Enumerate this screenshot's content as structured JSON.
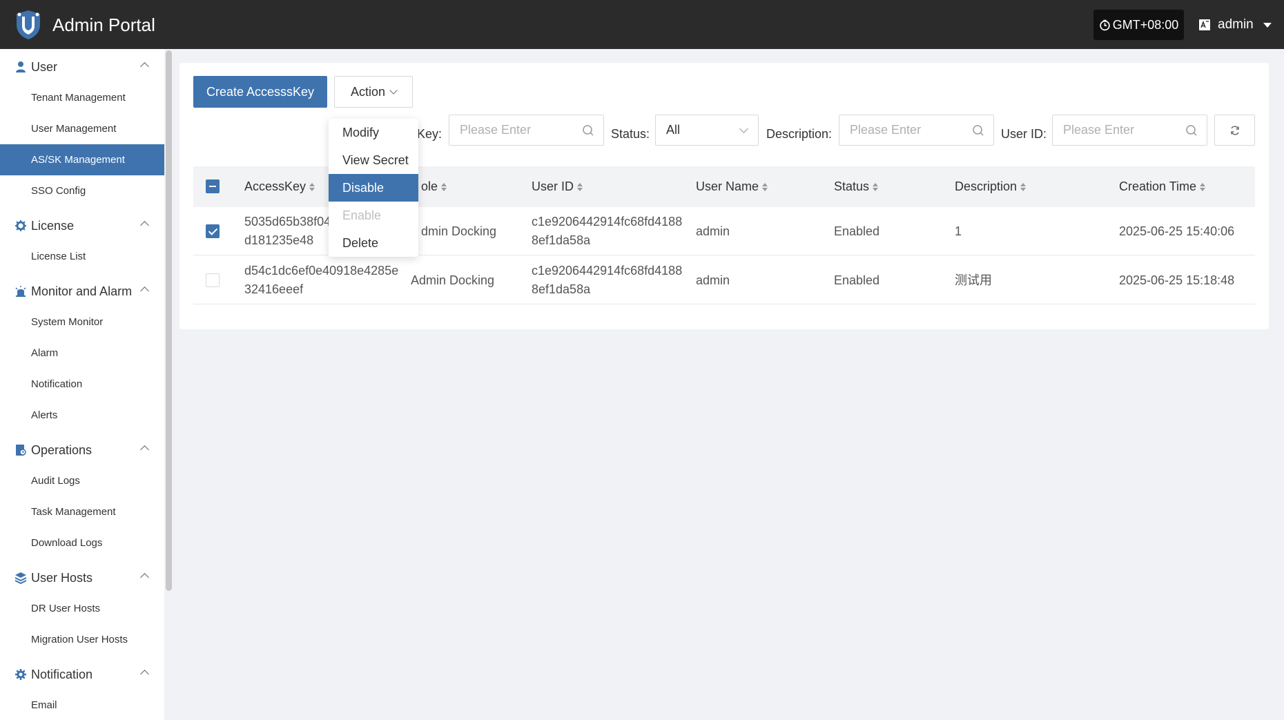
{
  "app": {
    "title": "Admin Portal"
  },
  "header": {
    "timezone": "GMT+08:00",
    "user": "admin"
  },
  "sidebar": {
    "groups": [
      {
        "label": "User",
        "icon": "user-icon",
        "items": [
          "Tenant Management",
          "User Management",
          "AS/SK Management",
          "SSO Config"
        ]
      },
      {
        "label": "License",
        "icon": "license-icon",
        "items": [
          "License List"
        ]
      },
      {
        "label": "Monitor and Alarm",
        "icon": "alarm-icon",
        "items": [
          "System Monitor",
          "Alarm",
          "Notification",
          "Alerts"
        ]
      },
      {
        "label": "Operations",
        "icon": "operations-icon",
        "items": [
          "Audit Logs",
          "Task Management",
          "Download Logs"
        ]
      },
      {
        "label": "User Hosts",
        "icon": "layers-icon",
        "items": [
          "DR User Hosts",
          "Migration User Hosts"
        ]
      },
      {
        "label": "Notification",
        "icon": "gear-icon",
        "items": [
          "Email"
        ]
      }
    ],
    "active_item": "AS/SK Management"
  },
  "toolbar": {
    "create_label": "Create AccesssKey",
    "action_label": "Action"
  },
  "action_menu": {
    "items": [
      {
        "label": "Modify",
        "state": "normal"
      },
      {
        "label": "View Secret",
        "state": "normal"
      },
      {
        "label": "Disable",
        "state": "selected"
      },
      {
        "label": "Enable",
        "state": "disabled"
      },
      {
        "label": "Delete",
        "state": "normal"
      }
    ]
  },
  "filters": {
    "key_label": "Key:",
    "key_placeholder": "Please Enter",
    "status_label": "Status:",
    "status_value": "All",
    "description_label": "Description:",
    "description_placeholder": "Please Enter",
    "userid_label": "User ID:",
    "userid_placeholder": "Please Enter"
  },
  "table": {
    "columns": [
      "AccessKey",
      "ole",
      "User ID",
      "User Name",
      "Status",
      "Description",
      "Creation Time"
    ],
    "rows": [
      {
        "checked": true,
        "accesskey_1": "5035d65b38f04",
        "accesskey_2": "d181235e48",
        "role": "dmin Docking",
        "userid_1": "c1e9206442914fc68fd4188",
        "userid_2": "8ef1da58a",
        "username": "admin",
        "status": "Enabled",
        "description": "1",
        "created": "2025-06-25 15:40:06"
      },
      {
        "checked": false,
        "accesskey_1": "d54c1dc6ef0e40918e4285e",
        "accesskey_2": "32416eeef",
        "role": "Admin Docking",
        "userid_1": "c1e9206442914fc68fd4188",
        "userid_2": "8ef1da58a",
        "username": "admin",
        "status": "Enabled",
        "description": "测试用",
        "created": "2025-06-25 15:18:48"
      }
    ]
  },
  "colors": {
    "accent": "#3e73ae",
    "header_bg": "#2b2b2b"
  }
}
